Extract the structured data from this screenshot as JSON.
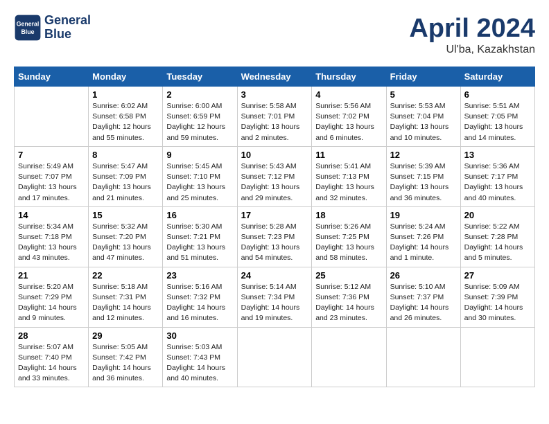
{
  "header": {
    "logo_line1": "General",
    "logo_line2": "Blue",
    "month": "April 2024",
    "location": "Ul'ba, Kazakhstan"
  },
  "weekdays": [
    "Sunday",
    "Monday",
    "Tuesday",
    "Wednesday",
    "Thursday",
    "Friday",
    "Saturday"
  ],
  "weeks": [
    [
      {
        "day": "",
        "sunrise": "",
        "sunset": "",
        "daylight": ""
      },
      {
        "day": "1",
        "sunrise": "Sunrise: 6:02 AM",
        "sunset": "Sunset: 6:58 PM",
        "daylight": "Daylight: 12 hours and 55 minutes."
      },
      {
        "day": "2",
        "sunrise": "Sunrise: 6:00 AM",
        "sunset": "Sunset: 6:59 PM",
        "daylight": "Daylight: 12 hours and 59 minutes."
      },
      {
        "day": "3",
        "sunrise": "Sunrise: 5:58 AM",
        "sunset": "Sunset: 7:01 PM",
        "daylight": "Daylight: 13 hours and 2 minutes."
      },
      {
        "day": "4",
        "sunrise": "Sunrise: 5:56 AM",
        "sunset": "Sunset: 7:02 PM",
        "daylight": "Daylight: 13 hours and 6 minutes."
      },
      {
        "day": "5",
        "sunrise": "Sunrise: 5:53 AM",
        "sunset": "Sunset: 7:04 PM",
        "daylight": "Daylight: 13 hours and 10 minutes."
      },
      {
        "day": "6",
        "sunrise": "Sunrise: 5:51 AM",
        "sunset": "Sunset: 7:05 PM",
        "daylight": "Daylight: 13 hours and 14 minutes."
      }
    ],
    [
      {
        "day": "7",
        "sunrise": "Sunrise: 5:49 AM",
        "sunset": "Sunset: 7:07 PM",
        "daylight": "Daylight: 13 hours and 17 minutes."
      },
      {
        "day": "8",
        "sunrise": "Sunrise: 5:47 AM",
        "sunset": "Sunset: 7:09 PM",
        "daylight": "Daylight: 13 hours and 21 minutes."
      },
      {
        "day": "9",
        "sunrise": "Sunrise: 5:45 AM",
        "sunset": "Sunset: 7:10 PM",
        "daylight": "Daylight: 13 hours and 25 minutes."
      },
      {
        "day": "10",
        "sunrise": "Sunrise: 5:43 AM",
        "sunset": "Sunset: 7:12 PM",
        "daylight": "Daylight: 13 hours and 29 minutes."
      },
      {
        "day": "11",
        "sunrise": "Sunrise: 5:41 AM",
        "sunset": "Sunset: 7:13 PM",
        "daylight": "Daylight: 13 hours and 32 minutes."
      },
      {
        "day": "12",
        "sunrise": "Sunrise: 5:39 AM",
        "sunset": "Sunset: 7:15 PM",
        "daylight": "Daylight: 13 hours and 36 minutes."
      },
      {
        "day": "13",
        "sunrise": "Sunrise: 5:36 AM",
        "sunset": "Sunset: 7:17 PM",
        "daylight": "Daylight: 13 hours and 40 minutes."
      }
    ],
    [
      {
        "day": "14",
        "sunrise": "Sunrise: 5:34 AM",
        "sunset": "Sunset: 7:18 PM",
        "daylight": "Daylight: 13 hours and 43 minutes."
      },
      {
        "day": "15",
        "sunrise": "Sunrise: 5:32 AM",
        "sunset": "Sunset: 7:20 PM",
        "daylight": "Daylight: 13 hours and 47 minutes."
      },
      {
        "day": "16",
        "sunrise": "Sunrise: 5:30 AM",
        "sunset": "Sunset: 7:21 PM",
        "daylight": "Daylight: 13 hours and 51 minutes."
      },
      {
        "day": "17",
        "sunrise": "Sunrise: 5:28 AM",
        "sunset": "Sunset: 7:23 PM",
        "daylight": "Daylight: 13 hours and 54 minutes."
      },
      {
        "day": "18",
        "sunrise": "Sunrise: 5:26 AM",
        "sunset": "Sunset: 7:25 PM",
        "daylight": "Daylight: 13 hours and 58 minutes."
      },
      {
        "day": "19",
        "sunrise": "Sunrise: 5:24 AM",
        "sunset": "Sunset: 7:26 PM",
        "daylight": "Daylight: 14 hours and 1 minute."
      },
      {
        "day": "20",
        "sunrise": "Sunrise: 5:22 AM",
        "sunset": "Sunset: 7:28 PM",
        "daylight": "Daylight: 14 hours and 5 minutes."
      }
    ],
    [
      {
        "day": "21",
        "sunrise": "Sunrise: 5:20 AM",
        "sunset": "Sunset: 7:29 PM",
        "daylight": "Daylight: 14 hours and 9 minutes."
      },
      {
        "day": "22",
        "sunrise": "Sunrise: 5:18 AM",
        "sunset": "Sunset: 7:31 PM",
        "daylight": "Daylight: 14 hours and 12 minutes."
      },
      {
        "day": "23",
        "sunrise": "Sunrise: 5:16 AM",
        "sunset": "Sunset: 7:32 PM",
        "daylight": "Daylight: 14 hours and 16 minutes."
      },
      {
        "day": "24",
        "sunrise": "Sunrise: 5:14 AM",
        "sunset": "Sunset: 7:34 PM",
        "daylight": "Daylight: 14 hours and 19 minutes."
      },
      {
        "day": "25",
        "sunrise": "Sunrise: 5:12 AM",
        "sunset": "Sunset: 7:36 PM",
        "daylight": "Daylight: 14 hours and 23 minutes."
      },
      {
        "day": "26",
        "sunrise": "Sunrise: 5:10 AM",
        "sunset": "Sunset: 7:37 PM",
        "daylight": "Daylight: 14 hours and 26 minutes."
      },
      {
        "day": "27",
        "sunrise": "Sunrise: 5:09 AM",
        "sunset": "Sunset: 7:39 PM",
        "daylight": "Daylight: 14 hours and 30 minutes."
      }
    ],
    [
      {
        "day": "28",
        "sunrise": "Sunrise: 5:07 AM",
        "sunset": "Sunset: 7:40 PM",
        "daylight": "Daylight: 14 hours and 33 minutes."
      },
      {
        "day": "29",
        "sunrise": "Sunrise: 5:05 AM",
        "sunset": "Sunset: 7:42 PM",
        "daylight": "Daylight: 14 hours and 36 minutes."
      },
      {
        "day": "30",
        "sunrise": "Sunrise: 5:03 AM",
        "sunset": "Sunset: 7:43 PM",
        "daylight": "Daylight: 14 hours and 40 minutes."
      },
      {
        "day": "",
        "sunrise": "",
        "sunset": "",
        "daylight": ""
      },
      {
        "day": "",
        "sunrise": "",
        "sunset": "",
        "daylight": ""
      },
      {
        "day": "",
        "sunrise": "",
        "sunset": "",
        "daylight": ""
      },
      {
        "day": "",
        "sunrise": "",
        "sunset": "",
        "daylight": ""
      }
    ]
  ]
}
